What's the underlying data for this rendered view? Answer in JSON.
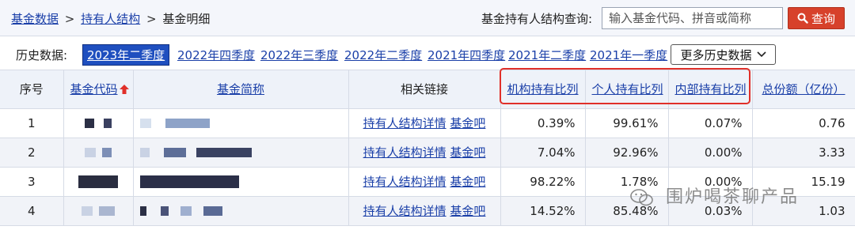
{
  "breadcrumb": {
    "items": [
      "基金数据",
      "持有人结构",
      "基金明细"
    ],
    "separator": ">"
  },
  "search": {
    "label": "基金持有人结构查询:",
    "placeholder": "输入基金代码、拼音或简称",
    "button_label": "查询"
  },
  "history": {
    "label": "历史数据:",
    "periods": [
      "2023年二季度",
      "2022年四季度",
      "2022年三季度",
      "2022年二季度",
      "2021年四季度",
      "2021年二季度",
      "2021年一季度"
    ],
    "active_index": 0,
    "more_label": "更多历史数据"
  },
  "table": {
    "headers": {
      "index": "序号",
      "code": "基金代码",
      "name": "基金简称",
      "links": "相关链接",
      "institutional": "机构持有比列",
      "individual": "个人持有比列",
      "internal": "内部持有比列",
      "total": "总份额（亿份）"
    },
    "link_labels": {
      "detail": "持有人结构详情",
      "bar": "基金吧"
    },
    "rows": [
      {
        "index": "1",
        "institutional": "0.39%",
        "individual": "99.61%",
        "internal": "0.07%",
        "total": "0.76"
      },
      {
        "index": "2",
        "institutional": "7.04%",
        "individual": "92.96%",
        "internal": "0.00%",
        "total": "3.33"
      },
      {
        "index": "3",
        "institutional": "98.22%",
        "individual": "1.78%",
        "internal": "0.00%",
        "total": "15.19"
      },
      {
        "index": "4",
        "institutional": "14.52%",
        "individual": "85.48%",
        "internal": "0.03%",
        "total": "1.03"
      }
    ]
  },
  "watermark": {
    "text": "围炉喝茶聊产品"
  },
  "colors": {
    "link": "#1a3fa8",
    "active_period_bg": "#1f4fbf",
    "search_button": "#d7412b",
    "highlight_box": "#e0302a",
    "sort_arrow": "#e0302a"
  }
}
